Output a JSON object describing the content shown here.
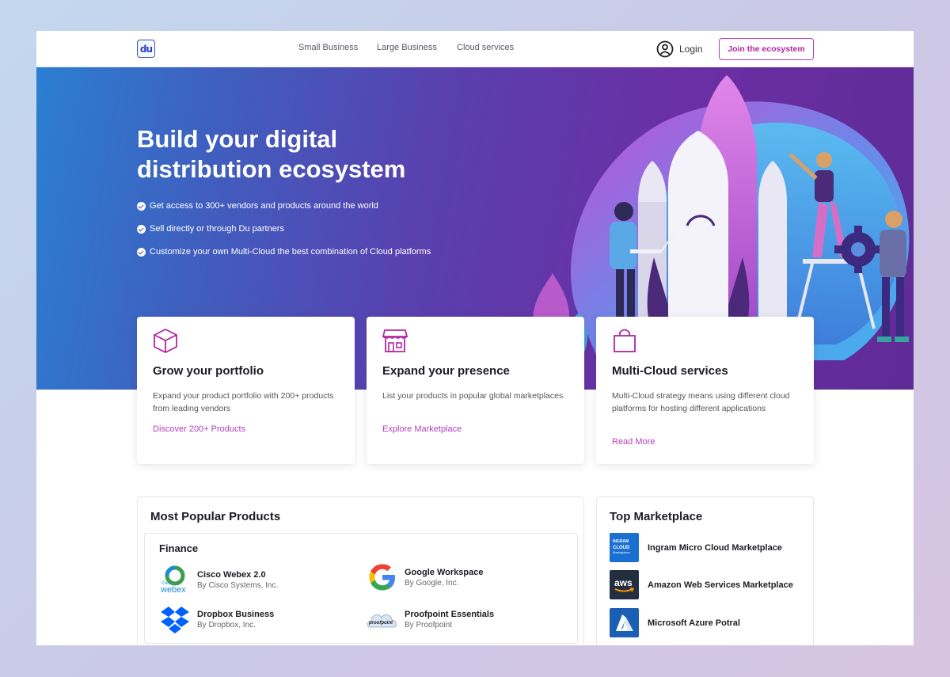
{
  "header": {
    "logo_text": "du",
    "nav": [
      "Small Business",
      "Large Business",
      "Cloud services"
    ],
    "login_label": "Login",
    "join_label": "Join the ecosystem"
  },
  "hero": {
    "title_line1": "Build your digital",
    "title_line2": "distribution ecosystem",
    "bullets": [
      "Get access to 300+ vendors and products around the world",
      "Sell directly or through Du partners",
      "Customize your own Multi-Cloud the best combination of Cloud platforms"
    ]
  },
  "cards": [
    {
      "title": "Grow your portfolio",
      "text": "Expand your product portfolio with 200+ products from leading vendors",
      "link": "Discover 200+ Products",
      "icon": "box-icon"
    },
    {
      "title": "Expand your presence",
      "text": "List your products in popular global marketplaces",
      "link": "Explore Marketplace",
      "icon": "store-icon"
    },
    {
      "title": "Multi-Cloud services",
      "text": "Multi-Cloud strategy means using different cloud platforms for hosting different applications",
      "link": "Read More",
      "icon": "shopping-bag-icon"
    }
  ],
  "popular": {
    "title": "Most Popular Products",
    "category": "Finance",
    "products": [
      {
        "name": "Cisco Webex 2.0",
        "by": "By Cisco Systems, Inc.",
        "logo_text": "webex",
        "logo_subtext": "Cisco"
      },
      {
        "name": "Google Workspace",
        "by": "By Google, Inc."
      },
      {
        "name": "Dropbox Business",
        "by": "By Dropbox, Inc."
      },
      {
        "name": "Proofpoint Essentials",
        "by": "By Proofpoint",
        "logo_text": "proofpoint"
      }
    ]
  },
  "marketplace": {
    "title": "Top Marketplace",
    "items": [
      {
        "name": "Ingram Micro Cloud Marketplace",
        "logo_text": "CLOUD",
        "logo_subtext": "Marketplace",
        "logo_brand": "INGRAM"
      },
      {
        "name": "Amazon Web Services Marketplace",
        "logo_text": "aws"
      },
      {
        "name": "Microsoft Azure Potral"
      }
    ]
  },
  "colors": {
    "accent": "#b0279f",
    "hero_start": "#2b7fd2",
    "hero_end": "#5f2b96"
  }
}
